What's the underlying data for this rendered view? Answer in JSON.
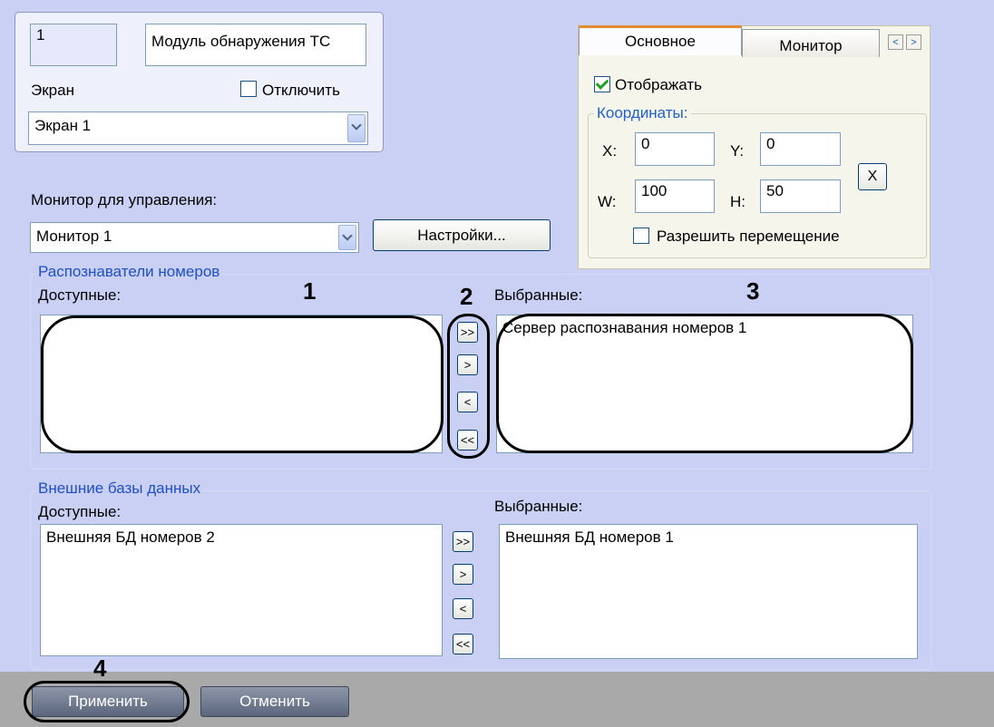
{
  "object": {
    "id": "1",
    "name": "Модуль обнаружения ТС",
    "screen_label": "Экран",
    "disable_label": "Отключить",
    "disable_checked": false,
    "screen_value": "Экран 1"
  },
  "monitor": {
    "label": "Монитор для управления:",
    "value": "Монитор 1",
    "settings_button": "Настройки..."
  },
  "tabs": {
    "items": [
      "Основное",
      "Монитор"
    ],
    "scroll_left": "<",
    "scroll_right": ">",
    "display_label": "Отображать",
    "display_checked": true,
    "coords_title": "Координаты:",
    "x_label": "X:",
    "x_value": "0",
    "y_label": "Y:",
    "y_value": "0",
    "w_label": "W:",
    "w_value": "100",
    "h_label": "H:",
    "h_value": "50",
    "reset_button": "X",
    "allow_move_label": "Разрешить перемещение",
    "allow_move_checked": false
  },
  "recognizers": {
    "title": "Распознаватели номеров",
    "available_label": "Доступные:",
    "selected_label": "Выбранные:",
    "available_items": [],
    "selected_items": [
      "Сервер распознавания номеров 1"
    ],
    "buttons": [
      ">>",
      ">",
      "<",
      "<<"
    ]
  },
  "external_db": {
    "title": "Внешние базы данных",
    "available_label": "Доступные:",
    "selected_label": "Выбранные:",
    "available_items": [
      "Внешняя БД номеров 2"
    ],
    "selected_items": [
      "Внешняя БД номеров 1"
    ],
    "buttons": [
      ">>",
      ">",
      "<",
      "<<"
    ]
  },
  "annotations": [
    "1",
    "2",
    "3",
    "4"
  ],
  "footer": {
    "apply_button": "Применить",
    "cancel_button": "Отменить"
  }
}
